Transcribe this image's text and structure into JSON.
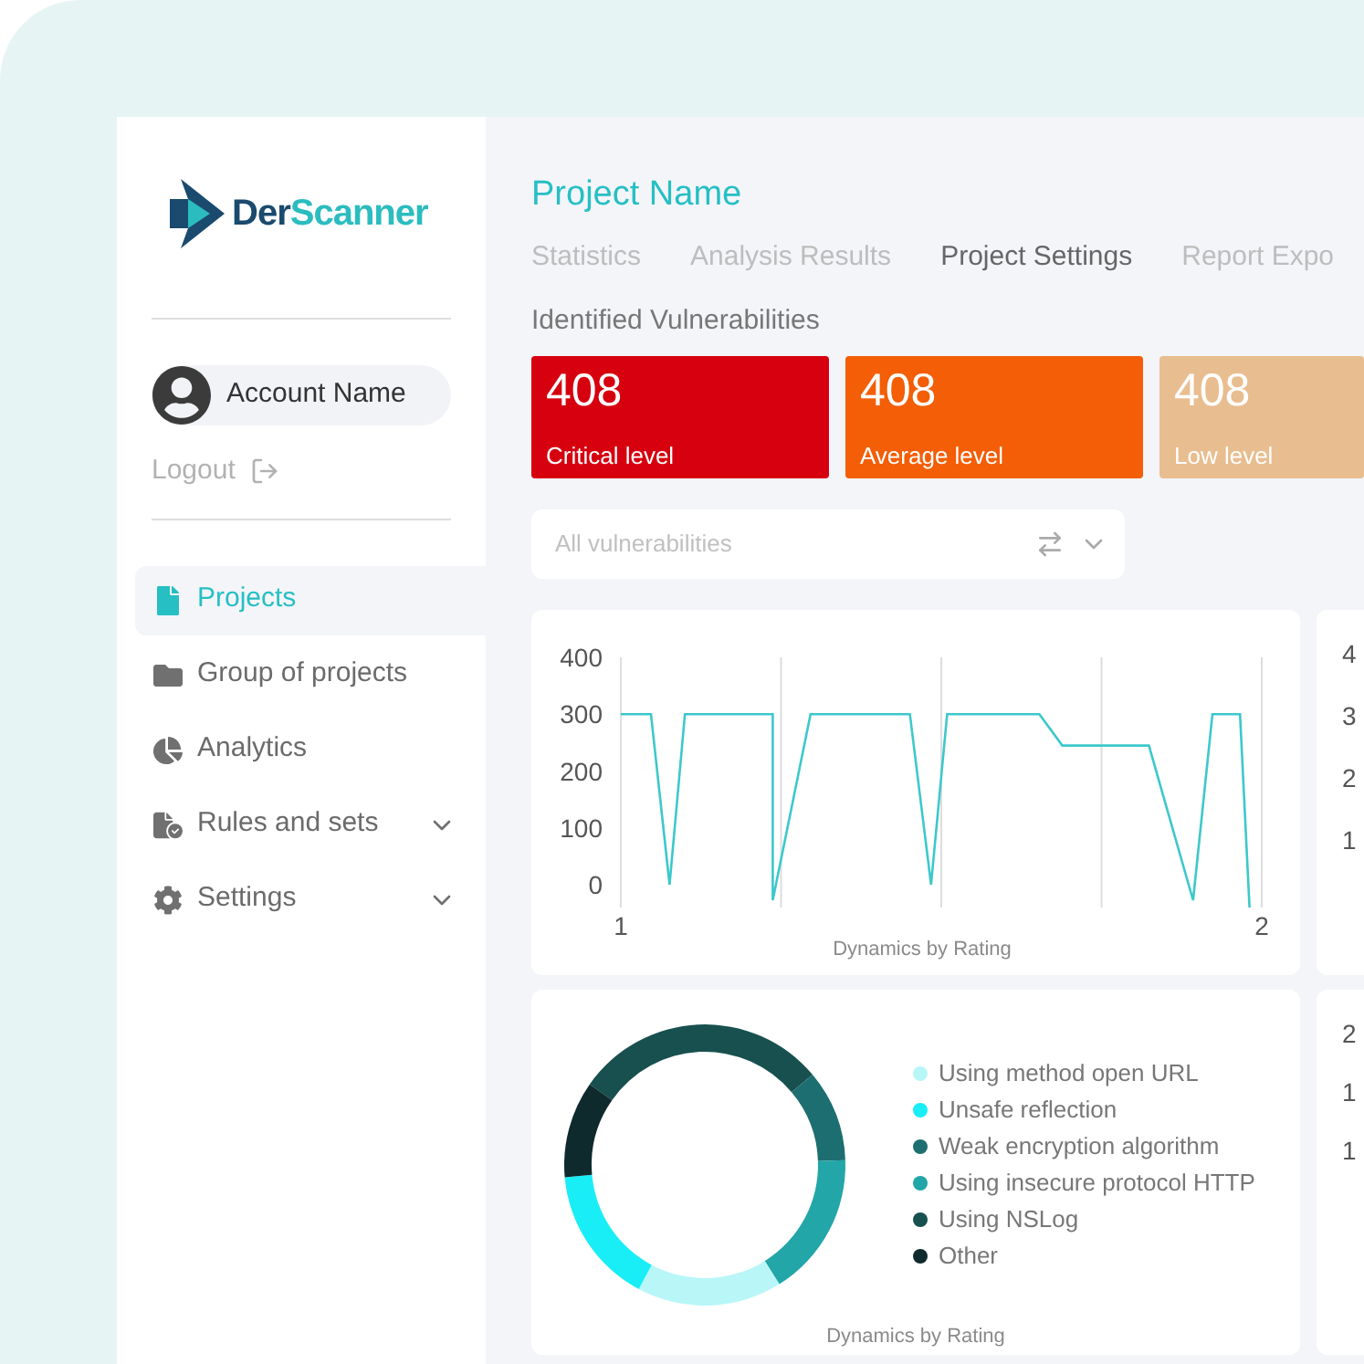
{
  "logo": {
    "text_dark": "Der",
    "text_accent": "Scanner"
  },
  "account": {
    "name": "Account Name"
  },
  "logout": {
    "label": "Logout"
  },
  "nav": [
    {
      "label": "Projects",
      "selected": true,
      "expandable": false
    },
    {
      "label": "Group of projects",
      "selected": false,
      "expandable": false
    },
    {
      "label": "Analytics",
      "selected": false,
      "expandable": false
    },
    {
      "label": "Rules and sets",
      "selected": false,
      "expandable": true
    },
    {
      "label": "Settings",
      "selected": false,
      "expandable": true
    }
  ],
  "project": {
    "title": "Project Name"
  },
  "tabs": [
    {
      "label": "Statistics",
      "selected": false
    },
    {
      "label": "Analysis Results",
      "selected": false
    },
    {
      "label": "Project Settings",
      "selected": true
    },
    {
      "label": "Report Expo",
      "selected": false
    }
  ],
  "section_title": "Identified Vulnerabilities",
  "stat_cards": [
    {
      "value": "408",
      "label": "Critical level",
      "color": "#d7000f"
    },
    {
      "value": "408",
      "label": "Average level",
      "color": "#f35e06"
    },
    {
      "value": "408",
      "label": "Low level",
      "color": "#e8bd8f"
    }
  ],
  "filter": {
    "placeholder": "All vulnerabilities"
  },
  "line_chart": {
    "chart_data": {
      "type": "line",
      "xlabel": "Dynamics by Rating",
      "xticks": [
        {
          "value": 1,
          "label": "1"
        },
        {
          "value": 2,
          "label": "2"
        }
      ],
      "yticks": [
        0,
        100,
        200,
        300,
        400
      ],
      "ylim": [
        -40,
        400
      ],
      "xlim": [
        1,
        2
      ],
      "x": [
        1,
        1.047,
        1.076,
        1.1,
        1.237,
        1.237,
        1.296,
        1.451,
        1.484,
        1.509,
        1.653,
        1.689,
        1.824,
        1.893,
        1.923,
        1.966,
        1.981
      ],
      "series": [
        {
          "color": "#3cc8cc",
          "values": [
            300,
            300,
            0,
            300,
            300,
            -27,
            300,
            300,
            0,
            300,
            300,
            245,
            245,
            -27,
            300,
            300,
            -40
          ]
        }
      ]
    }
  },
  "right_chart_1": {
    "tick_labels": [
      "4",
      "3",
      "2",
      "1"
    ]
  },
  "donut": {
    "caption": "Dynamics by Rating",
    "legend": [
      {
        "label": "Using method open URL",
        "color": "#b8f6f8"
      },
      {
        "label": "Unsafe reflection",
        "color": "#19eef7"
      },
      {
        "label": "Weak encryption algorithm",
        "color": "#1d6e70"
      },
      {
        "label": "Using insecure protocol HTTP",
        "color": "#22a6a8"
      },
      {
        "label": "Using NSLog",
        "color": "#17504f"
      },
      {
        "label": "Other",
        "color": "#0e2a2c"
      }
    ]
  },
  "right_chart_2": {
    "tick_labels": [
      "2",
      "1",
      "1"
    ]
  }
}
